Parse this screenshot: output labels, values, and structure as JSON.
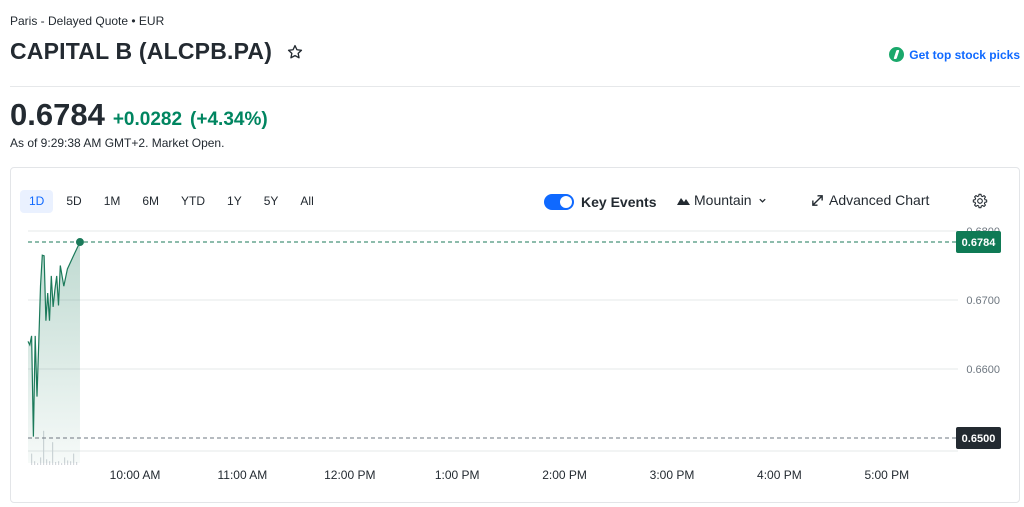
{
  "header": {
    "exchange_line": "Paris - Delayed Quote • EUR",
    "title": "CAPITAL B (ALCPB.PA)",
    "top_picks": "Get top stock picks"
  },
  "quote": {
    "price": "0.6784",
    "change": "+0.0282",
    "change_pct": "(+4.34%)",
    "as_of": "As of 9:29:38 AM GMT+2. Market Open."
  },
  "toolbar": {
    "ranges": [
      "1D",
      "5D",
      "1M",
      "6M",
      "YTD",
      "1Y",
      "5Y",
      "All"
    ],
    "active_range": "1D",
    "key_events_label": "Key Events",
    "key_events_on": true,
    "chart_type_label": "Mountain",
    "advanced_chart_label": "Advanced Chart"
  },
  "icons": [
    "star-icon",
    "top-picks-icon",
    "mountain-icon",
    "chevron-down-icon",
    "expand-icon",
    "gear-icon"
  ],
  "colors": {
    "accent": "#0f69ff",
    "up": "#008560",
    "line": "#1b7a5a",
    "prev_close_label": "#232a31"
  },
  "chart_data": {
    "type": "area",
    "ylim": [
      0.65,
      0.68
    ],
    "y_ticks": [
      "0.6800",
      "0.6700",
      "0.6600"
    ],
    "x_ticks": [
      "10:00 AM",
      "11:00 AM",
      "12:00 PM",
      "1:00 PM",
      "2:00 PM",
      "3:00 PM",
      "4:00 PM",
      "5:00 PM"
    ],
    "current_label": "0.6784",
    "current_value": 0.6784,
    "prev_close_label": "0.6500",
    "prev_close_value": 0.65,
    "grid": true,
    "series": [
      {
        "x": [
          "9:00",
          "9:01",
          "9:02",
          "9:03",
          "9:04",
          "9:05",
          "9:06",
          "9:07",
          "9:08",
          "9:09",
          "9:10",
          "9:11",
          "9:12",
          "9:13",
          "9:14",
          "9:15",
          "9:16",
          "9:17",
          "9:18",
          "9:20",
          "9:22",
          "9:25",
          "9:29"
        ],
        "y": [
          0.664,
          0.6635,
          0.6648,
          0.6502,
          0.6648,
          0.656,
          0.664,
          0.672,
          0.6765,
          0.6764,
          0.667,
          0.671,
          0.667,
          0.6735,
          0.669,
          0.6715,
          0.6735,
          0.6692,
          0.675,
          0.672,
          0.6745,
          0.6762,
          0.6784
        ]
      }
    ],
    "volume": [
      0.3,
      0.1,
      0.05,
      0.2,
      0.9,
      0.15,
      0.1,
      0.6,
      0.08,
      0.1,
      0.05,
      0.2,
      0.12,
      0.1,
      0.3,
      0.08
    ]
  }
}
